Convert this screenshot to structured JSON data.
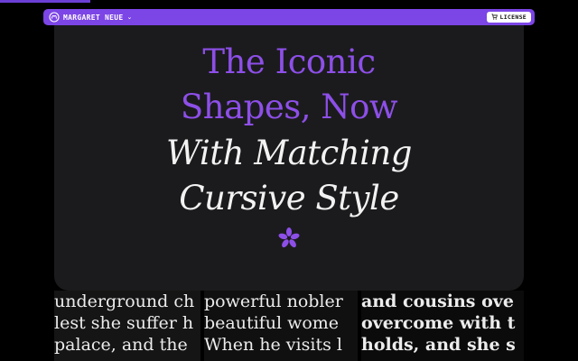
{
  "nav": {
    "brand_name": "MARGARET NEUE",
    "brand_chevron_icon": "chevron-down",
    "license_icon": "cart",
    "license_label": "LICENSE"
  },
  "hero": {
    "line1": "The Iconic",
    "line2": "Shapes, Now",
    "line3": "With Matching",
    "line4": "Cursive Style",
    "ornament_icon": "asterisk",
    "colors": {
      "purple": "#8d4fe8",
      "white": "#f2f2f2",
      "card": "#1b1b1d"
    }
  },
  "specimens": {
    "col1": [
      "underground ch",
      "lest she suffer h",
      "palace, and the"
    ],
    "col2": [
      "powerful nobler",
      "beautiful wome",
      "When he visits l"
    ],
    "col3": [
      "and cousins ove",
      "overcome with t",
      "holds, and she s"
    ]
  },
  "colors": {
    "accent": "#7c45e6",
    "background": "#000000"
  }
}
